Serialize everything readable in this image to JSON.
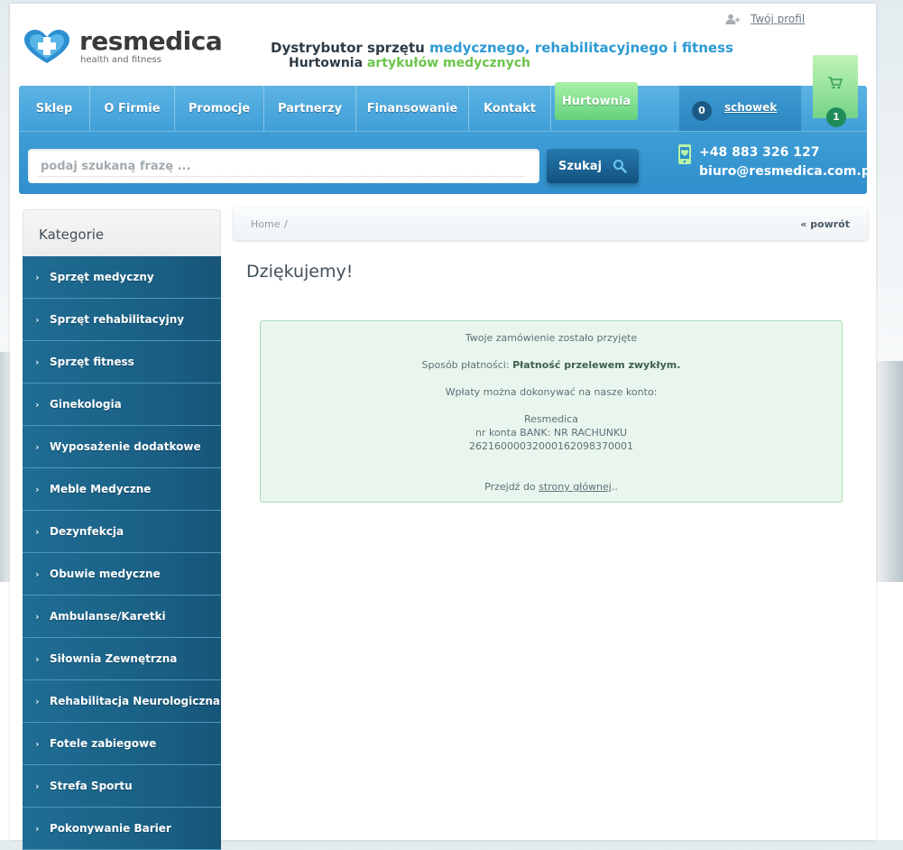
{
  "header": {
    "logo_name": "resmedica",
    "logo_sub": "health and fitness",
    "tagline1_prefix": "Dystrybutor sprzętu ",
    "tagline1_highlight": "medycznego, rehabilitacyjnego i fitness",
    "tagline2_prefix": "Hurtownia ",
    "tagline2_highlight": "artykułów medycznych",
    "profile_link": "Twój profil",
    "profile_icon": "user-icon"
  },
  "nav": {
    "items": [
      "Sklep",
      "O Firmie",
      "Promocje",
      "Partnerzy",
      "Finansowanie",
      "Kontakt"
    ],
    "highlight_item": "Hurtownia",
    "schowek_count": "0",
    "schowek_label": "schowek",
    "cart_count": "1",
    "cart_icon": "cart-icon"
  },
  "search": {
    "placeholder": "podaj szukaną frazę ...",
    "button_label": "Szukaj",
    "button_icon": "search-icon"
  },
  "contact": {
    "phone": "+48 883 326 127",
    "email": "biuro@resmedica.com.pl",
    "icon": "phone-icon"
  },
  "sidebar": {
    "title": "Kategorie",
    "items": [
      "Sprzęt medyczny",
      "Sprzęt rehabilitacyjny",
      "Sprzęt fitness",
      "Ginekologia",
      "Wyposażenie dodatkowe",
      "Meble Medyczne",
      "Dezynfekcja",
      "Obuwie medyczne",
      "Ambulanse/Karetki",
      "Siłownia Zewnętrzna",
      "Rehabilitacja Neurologiczna",
      "Fotele zabiegowe",
      "Strefa Sportu",
      "Pokonywanie Barier"
    ]
  },
  "breadcrumb": {
    "home": "Home",
    "separator": "/",
    "back": "« powrót"
  },
  "main": {
    "title": "Dziękujemy!",
    "notice": {
      "line1": "Twoje zamówienie zostało przyjęte",
      "payment_label": "Sposób płatności: ",
      "payment_value": "Płatność przelewem zwykłym.",
      "line3": "Wpłaty można dokonywać na nasze konto:",
      "company": "Resmedica",
      "account_label": "nr konta BANK: NR RACHUNKU",
      "account_number": "26216000032000162098370001",
      "goto_prefix": "Przejdź do ",
      "goto_link": "strony głównej",
      "goto_suffix": ".."
    }
  },
  "colors": {
    "nav_blue": "#3e9dd6",
    "sidebar_blue": "#1a5f84",
    "green_accent": "#6cc54a",
    "notice_bg": "#e9f6ee"
  }
}
